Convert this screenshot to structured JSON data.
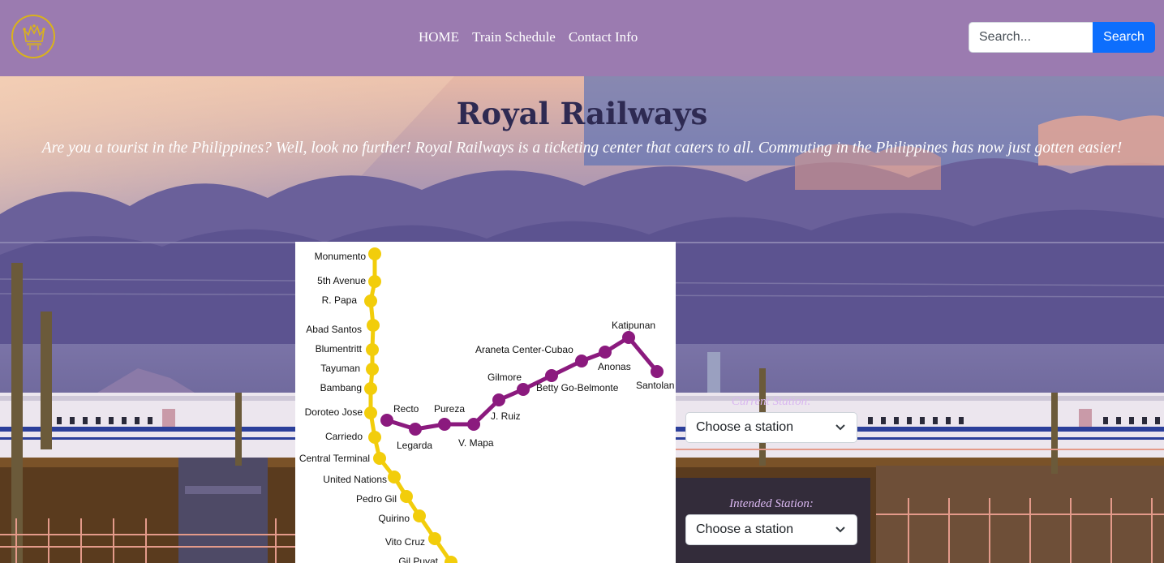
{
  "nav": {
    "links": [
      {
        "label": "HOME"
      },
      {
        "label": "Train Schedule"
      },
      {
        "label": "Contact Info"
      }
    ],
    "search_placeholder": "Search...",
    "search_button": "Search"
  },
  "hero": {
    "title": "Royal Railways",
    "tagline": "Are you a tourist in the Philippines? Well, look no further! Royal Railways is a ticketing center that caters to all. Commuting in the Philippines has now just gotten easier!"
  },
  "map": {
    "yellow_line_color": "#f2cd0b",
    "purple_line_color": "#8b1a7e",
    "yellow_stations": [
      "Monumento",
      "5th Avenue",
      "R. Papa",
      "Abad Santos",
      "Blumentritt",
      "Tayuman",
      "Bambang",
      "Doroteo Jose",
      "Carriedo",
      "Central Terminal",
      "United Nations",
      "Pedro Gil",
      "Quirino",
      "Vito Cruz",
      "Gil Puyat"
    ],
    "purple_stations": [
      "Recto",
      "Legarda",
      "Pureza",
      "V. Mapa",
      "J. Ruiz",
      "Gilmore",
      "Betty Go-Belmonte",
      "Araneta Center-Cubao",
      "Anonas",
      "Katipunan",
      "Santolan"
    ]
  },
  "form": {
    "current_label": "Current Station:",
    "current_value": "Choose a station",
    "intended_label": "Intended Station:",
    "intended_value": "Choose a station"
  },
  "colors": {
    "navbar": "#9b7bb0",
    "search_button": "#0d6efd",
    "logo_gold": "#d9b21c"
  }
}
